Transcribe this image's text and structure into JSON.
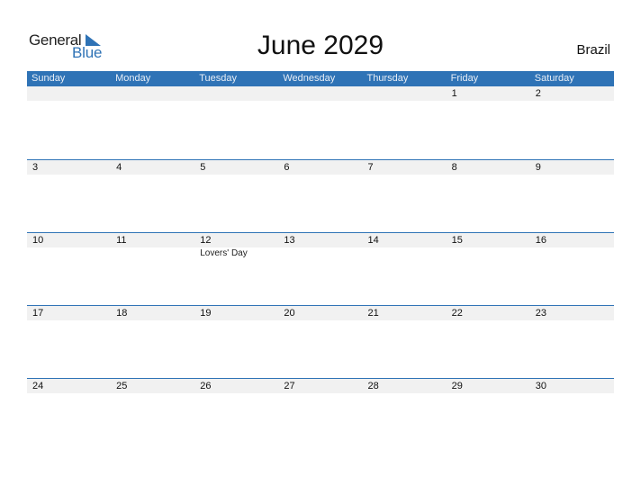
{
  "logo": {
    "general": "General",
    "blue": "Blue"
  },
  "title": "June 2029",
  "country": "Brazil",
  "colors": {
    "accent": "#2f73b6",
    "band": "#f1f1f1"
  },
  "weekdays": [
    "Sunday",
    "Monday",
    "Tuesday",
    "Wednesday",
    "Thursday",
    "Friday",
    "Saturday"
  ],
  "weeks": [
    {
      "days": [
        {
          "n": "",
          "e": ""
        },
        {
          "n": "",
          "e": ""
        },
        {
          "n": "",
          "e": ""
        },
        {
          "n": "",
          "e": ""
        },
        {
          "n": "",
          "e": ""
        },
        {
          "n": "1",
          "e": ""
        },
        {
          "n": "2",
          "e": ""
        }
      ]
    },
    {
      "days": [
        {
          "n": "3",
          "e": ""
        },
        {
          "n": "4",
          "e": ""
        },
        {
          "n": "5",
          "e": ""
        },
        {
          "n": "6",
          "e": ""
        },
        {
          "n": "7",
          "e": ""
        },
        {
          "n": "8",
          "e": ""
        },
        {
          "n": "9",
          "e": ""
        }
      ]
    },
    {
      "days": [
        {
          "n": "10",
          "e": ""
        },
        {
          "n": "11",
          "e": ""
        },
        {
          "n": "12",
          "e": "Lovers' Day"
        },
        {
          "n": "13",
          "e": ""
        },
        {
          "n": "14",
          "e": ""
        },
        {
          "n": "15",
          "e": ""
        },
        {
          "n": "16",
          "e": ""
        }
      ]
    },
    {
      "days": [
        {
          "n": "17",
          "e": ""
        },
        {
          "n": "18",
          "e": ""
        },
        {
          "n": "19",
          "e": ""
        },
        {
          "n": "20",
          "e": ""
        },
        {
          "n": "21",
          "e": ""
        },
        {
          "n": "22",
          "e": ""
        },
        {
          "n": "23",
          "e": ""
        }
      ]
    },
    {
      "days": [
        {
          "n": "24",
          "e": ""
        },
        {
          "n": "25",
          "e": ""
        },
        {
          "n": "26",
          "e": ""
        },
        {
          "n": "27",
          "e": ""
        },
        {
          "n": "28",
          "e": ""
        },
        {
          "n": "29",
          "e": ""
        },
        {
          "n": "30",
          "e": ""
        }
      ]
    }
  ]
}
